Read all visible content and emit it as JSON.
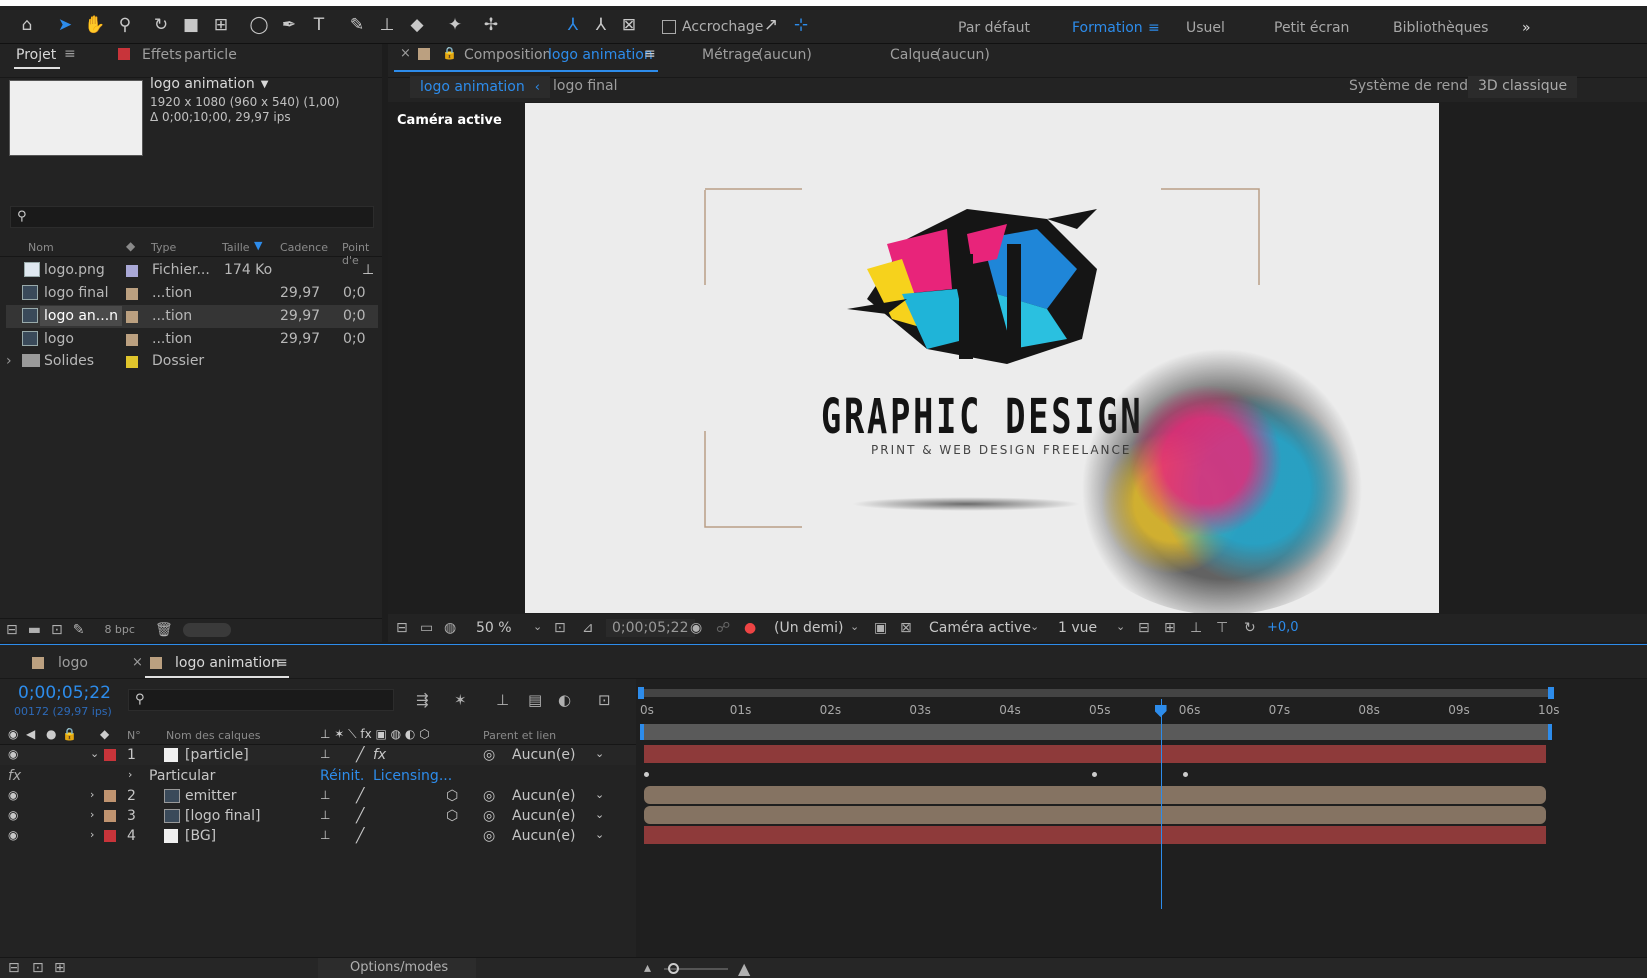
{
  "toolbar": {
    "snapping_label": "Accrochage",
    "workspaces": [
      "Par défaut",
      "Formation",
      "Usuel",
      "Petit écran",
      "Bibliothèques"
    ],
    "active_workspace": "Formation"
  },
  "project_panel": {
    "tab_project": "Projet",
    "tab_effects": "Effets",
    "effects_target": "particle",
    "selected_name": "logo animation",
    "selected_info_line1": "1920 x 1080  (960 x 540) (1,00)",
    "selected_info_line2": "Δ 0;00;10;00, 29,97 ips",
    "columns": [
      "Nom",
      "Type",
      "Taille",
      "Cadence",
      "Point d'e"
    ],
    "items": [
      {
        "name": "logo.png",
        "type": "Fichier...",
        "size": "174 Ko",
        "rate": "",
        "point": "",
        "color": "#a9a8d6"
      },
      {
        "name": "logo final",
        "type": "...tion",
        "size": "",
        "rate": "29,97",
        "point": "0;0",
        "color": "#bba080"
      },
      {
        "name": "logo an...n",
        "type": "...tion",
        "size": "",
        "rate": "29,97",
        "point": "0;0",
        "color": "#bba080"
      },
      {
        "name": "logo",
        "type": "...tion",
        "size": "",
        "rate": "29,97",
        "point": "0;0",
        "color": "#bba080"
      },
      {
        "name": "Solides",
        "type": "Dossier",
        "size": "",
        "rate": "",
        "point": "",
        "color": "#e0c52c"
      }
    ],
    "bpc": "8 bpc"
  },
  "comp_panel": {
    "tab_label": "Composition",
    "comp_name": "logo animation",
    "footage_label": "Métrage",
    "footage_value": "(aucun)",
    "layer_label": "Calque",
    "layer_value": "(aucun)",
    "breadcrumb_active": "logo animation",
    "breadcrumb_other": "logo final",
    "renderer_label": "Système de rendu :",
    "renderer_value": "3D  classique",
    "camera_label": "Caméra active",
    "logo_title": "GRAPHIC DESIGN",
    "logo_subtitle": "PRINT & WEB DESIGN FREELANCE",
    "zoom": "50 %",
    "timecode": "0;00;05;22",
    "resolution": "(Un demi)",
    "view_camera": "Caméra active",
    "views": "1 vue",
    "exposure": "+0,0"
  },
  "timeline": {
    "tabs": [
      "logo",
      "logo animation"
    ],
    "current_time": "0;00;05;22",
    "frame_info": "00172 (29,97 ips)",
    "col_number": "N°",
    "col_layer_name": "Nom des calques",
    "col_parent": "Parent et lien",
    "ruler": [
      "0s",
      "01s",
      "02s",
      "03s",
      "04s",
      "05s",
      "06s",
      "07s",
      "08s",
      "09s",
      "10s"
    ],
    "playhead_seconds": 5.73,
    "duration_seconds": 10,
    "layers": [
      {
        "num": "1",
        "name": "[particle]",
        "color": "#c8343a",
        "parent": "Aucun(e)",
        "bar_color": "#8e3a3a"
      },
      {
        "num": "2",
        "name": "emitter",
        "color": "#c09470",
        "parent": "Aucun(e)",
        "bar_color": "#857362"
      },
      {
        "num": "3",
        "name": "[logo final]",
        "color": "#c09470",
        "parent": "Aucun(e)",
        "bar_color": "#857362"
      },
      {
        "num": "4",
        "name": "[BG]",
        "color": "#c8343a",
        "parent": "Aucun(e)",
        "bar_color": "#8e3a3a"
      }
    ],
    "effect_name": "Particular",
    "effect_reset": "Réinit.",
    "effect_licensing": "Licensing...",
    "options_modes": "Options/modes"
  }
}
